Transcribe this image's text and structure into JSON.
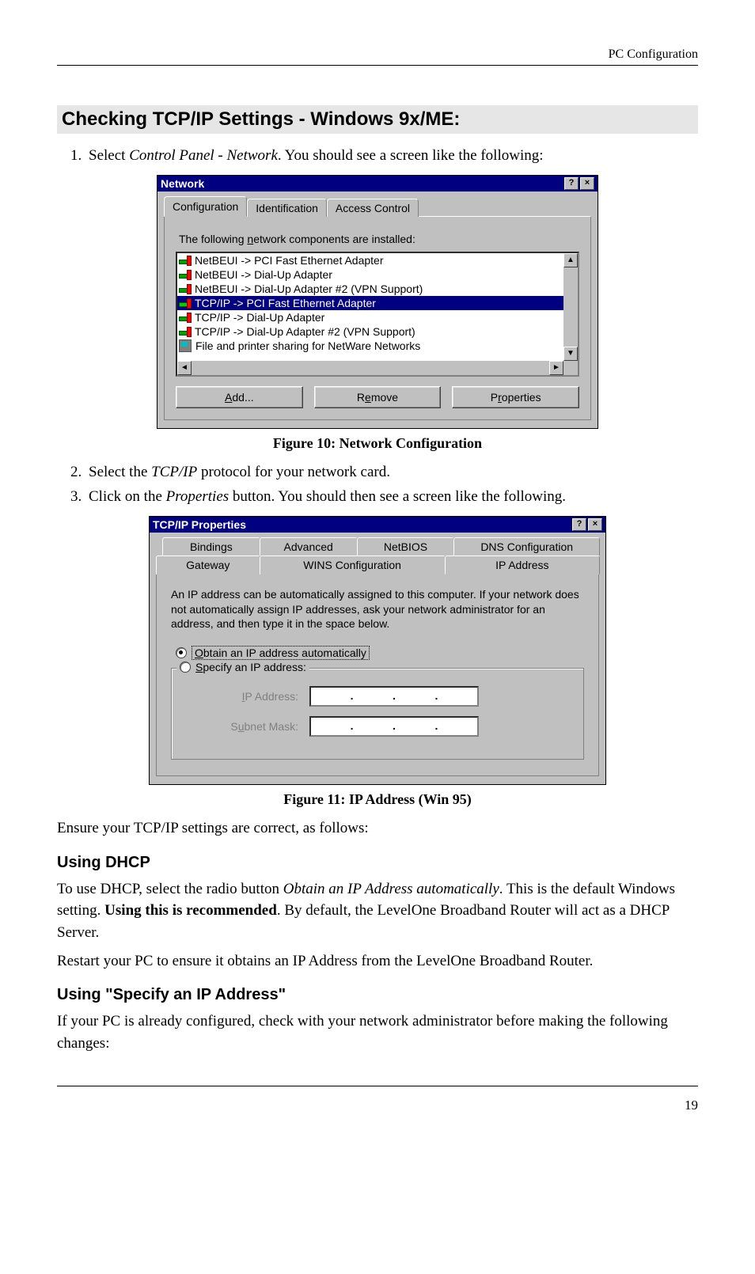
{
  "header": {
    "right": "PC Configuration"
  },
  "footer": {
    "page": "19"
  },
  "section": {
    "title": "Checking TCP/IP Settings - Windows 9x/ME:",
    "step1_pre": "Select ",
    "step1_italic": "Control Panel - Network",
    "step1_post": ". You should see a screen like the following:",
    "fig10": "Figure 10: Network Configuration",
    "step2_pre": "Select the ",
    "step2_italic": "TCP/IP",
    "step2_post": " protocol for your network card.",
    "step3_pre": "Click on the ",
    "step3_italic": "Properties",
    "step3_post": " button. You should then see a screen like the following.",
    "fig11": "Figure 11: IP Address (Win 95)",
    "ensure": "Ensure your TCP/IP settings are correct, as follows:",
    "dhcp_heading": "Using DHCP",
    "dhcp_p1_pre": "To use DHCP, select the radio button ",
    "dhcp_p1_italic": "Obtain an IP Address automatically",
    "dhcp_p1_mid": ". This is the default Windows setting. ",
    "dhcp_p1_bold": "Using this is recommended",
    "dhcp_p1_post": ". By default, the LevelOne Broadband Router will act as a DHCP Server.",
    "dhcp_p2": "Restart your PC to ensure it obtains an IP Address from the LevelOne Broadband Router.",
    "specify_heading": "Using \"Specify an IP Address\"",
    "specify_p": "If your PC is already configured, check with your network administrator before making the following changes:"
  },
  "win1": {
    "title": "Network",
    "help": "?",
    "close": "×",
    "tabs": {
      "t1": "Configuration",
      "t2": "Identification",
      "t3": "Access Control"
    },
    "desc_pre": "The following ",
    "desc_u": "n",
    "desc_post": "etwork components are installed:",
    "items": {
      "i0": "NetBEUI -> PCI Fast Ethernet Adapter",
      "i1": "NetBEUI -> Dial-Up Adapter",
      "i2": "NetBEUI -> Dial-Up Adapter #2 (VPN Support)",
      "i3": "TCP/IP -> PCI Fast Ethernet Adapter",
      "i4": "TCP/IP -> Dial-Up Adapter",
      "i5": "TCP/IP -> Dial-Up Adapter #2 (VPN Support)",
      "i6": "File and printer sharing for NetWare Networks"
    },
    "arrows": {
      "up": "▲",
      "down": "▼",
      "left": "◄",
      "right": "►"
    },
    "btns": {
      "add_u": "A",
      "add_rest": "dd...",
      "rem_pre": "R",
      "rem_u": "e",
      "rem_post": "move",
      "prop_pre": "P",
      "prop_u": "r",
      "prop_post": "operties"
    }
  },
  "win2": {
    "title": "TCP/IP Properties",
    "help": "?",
    "close": "×",
    "tabs": {
      "bindings": "Bindings",
      "advanced": "Advanced",
      "netbios": "NetBIOS",
      "dns": "DNS Configuration",
      "gateway": "Gateway",
      "wins": "WINS Configuration",
      "ip": "IP Address"
    },
    "info": "An IP address can be automatically assigned to this computer.  If your network does not automatically assign IP addresses, ask your network administrator for an address, and then type it in the space below.",
    "obtain_u": "O",
    "obtain_rest": "btain an IP address automatically",
    "specify_u": "S",
    "specify_rest": "pecify an IP address:",
    "ip_u": "I",
    "ip_rest": "P Address:",
    "mask_pre": "S",
    "mask_u": "u",
    "mask_rest": "bnet Mask:"
  }
}
